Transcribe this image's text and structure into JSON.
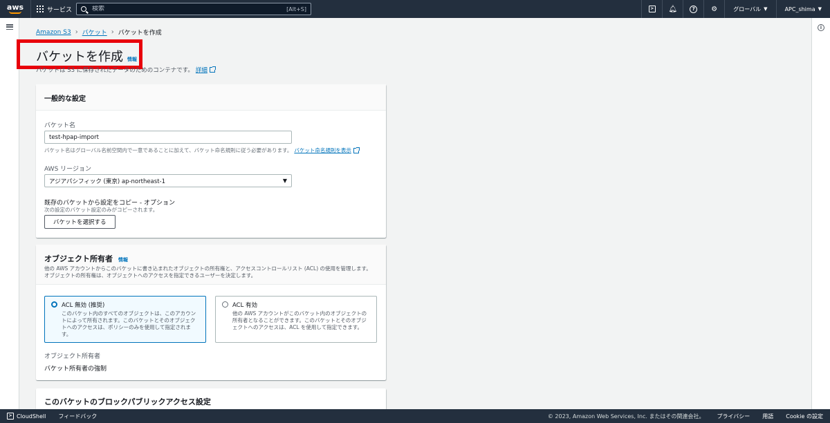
{
  "topnav": {
    "logo": "aws",
    "services": "サービス",
    "search_placeholder": "検索",
    "search_shortcut": "[Alt+S]",
    "region": "グローバル",
    "account": "APC_shima"
  },
  "breadcrumb": {
    "items": [
      "Amazon S3",
      "バケット"
    ],
    "current": "バケットを作成"
  },
  "header": {
    "title": "バケットを作成",
    "info": "情報",
    "description": "バケットは S3 に保存されたデータのためのコンテナです。",
    "more_link": "詳細"
  },
  "general": {
    "title": "一般的な設定",
    "bucket_name_label": "バケット名",
    "bucket_name_value": "test-hpap-import",
    "bucket_name_help": "バケット名はグローバル名前空間内で一意であることに加えて、バケット命名規則に従う必要があります。",
    "bucket_name_help_link": "バケット命名規則を表示",
    "region_label": "AWS リージョン",
    "region_value": "アジアパシフィック (東京) ap-northeast-1",
    "copy_title": "既存のバケットから設定をコピー - オプション",
    "copy_sub": "次の設定のバケット設定のみがコピーされます。",
    "choose_bucket_button": "バケットを選択する"
  },
  "ownership": {
    "title": "オブジェクト所有者",
    "info": "情報",
    "desc_line1": "他の AWS アカウントからこのバケットに書き込まれたオブジェクトの所有権と、アクセスコントロールリスト (ACL) の使用を管理します。",
    "desc_line2": "オブジェクトの所有権は、オブジェクトへのアクセスを指定できるユーザーを決定します。",
    "option1_label": "ACL 無効 (推奨)",
    "option1_desc": "このバケット内のすべてのオブジェクトは、このアカウントによって所有されます。このバケットとそのオブジェクトへのアクセスは、ポリシーのみを使用して指定されます。",
    "option2_label": "ACL 有効",
    "option2_desc": "他の AWS アカウントがこのバケット内のオブジェクトの所有者となることができます。このバケットとそのオブジェクトへのアクセスは、ACL を使用して指定できます。",
    "owner_label": "オブジェクト所有者",
    "owner_value": "バケット所有者の強制"
  },
  "block_public": {
    "title": "このバケットのブロックパブリックアクセス設定"
  },
  "footer": {
    "cloudshell": "CloudShell",
    "feedback": "フィードバック",
    "copyright": "© 2023, Amazon Web Services, Inc. またはその関連会社。",
    "privacy": "プライバシー",
    "terms": "用語",
    "cookie": "Cookie の設定"
  }
}
